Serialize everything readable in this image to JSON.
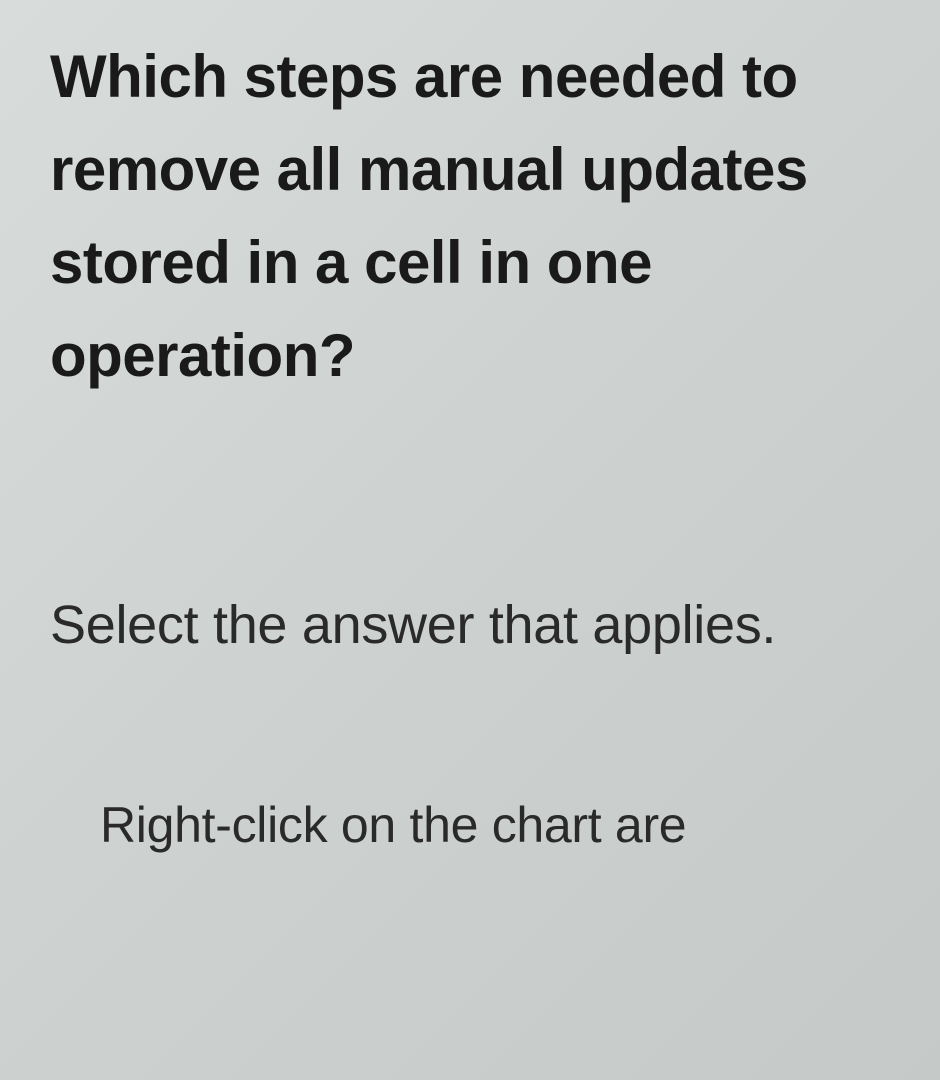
{
  "question": {
    "text": "Which steps are needed to remove all manual updates stored in a cell in one operation?"
  },
  "instruction": {
    "text": "Select the answer that applies."
  },
  "answers": {
    "option1": "Right-click on the chart are"
  }
}
